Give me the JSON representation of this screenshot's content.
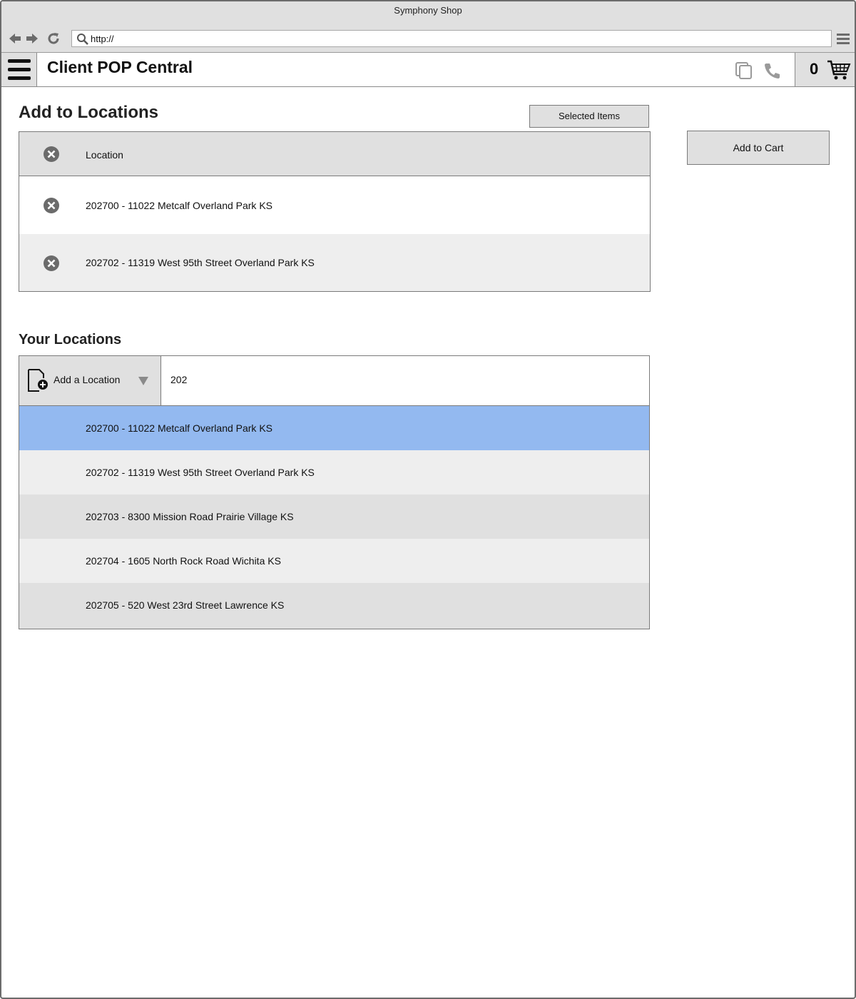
{
  "browser": {
    "window_title": "Symphony Shop",
    "url": "http://"
  },
  "app": {
    "title": "Client POP Central",
    "cart_count": "0"
  },
  "add_section": {
    "title": "Add to Locations",
    "selected_items_button": "Selected Items",
    "add_to_cart_button": "Add to Cart",
    "table": {
      "header": "Location",
      "rows": [
        "202700 - 11022 Metcalf Overland Park KS",
        "202702 - 11319 West 95th Street Overland Park KS"
      ]
    }
  },
  "locations_section": {
    "title": "Your Locations",
    "add_location_label": "Add a Location",
    "search_value": "202",
    "options": [
      "202700 - 11022 Metcalf Overland Park KS",
      "202702 - 11319 West 95th Street Overland Park KS",
      "202703 - 8300 Mission Road Prairie Village KS",
      "202704 - 1605 North Rock Road Wichita KS",
      "202705 - 520 West 23rd Street Lawrence KS"
    ],
    "highlighted_index": 0
  },
  "colors": {
    "chrome": "#e0e0e0",
    "highlight": "#93b9f0",
    "row_alt": "#eeeeee",
    "row_dark": "#e0e0e0",
    "icon_gray": "#6b6b6b"
  }
}
